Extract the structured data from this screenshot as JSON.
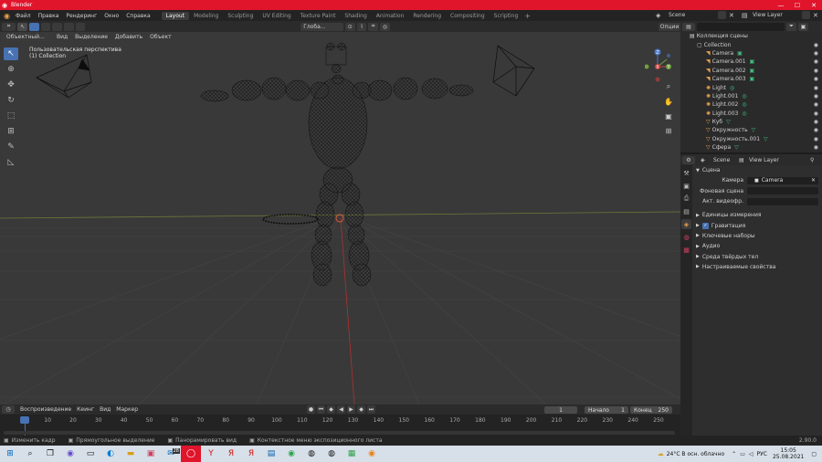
{
  "window": {
    "title": "Blender"
  },
  "menu": [
    "Файл",
    "Правка",
    "Рендеринг",
    "Окно",
    "Справка"
  ],
  "workspaces": [
    "Layout",
    "Modeling",
    "Sculpting",
    "UV Editing",
    "Texture Paint",
    "Shading",
    "Animation",
    "Rendering",
    "Compositing",
    "Scripting"
  ],
  "top_right": {
    "scene": "Scene",
    "view_layer": "View Layer"
  },
  "header": {
    "mode": "Объектный...",
    "menus": [
      "Вид",
      "Выделение",
      "Добавить",
      "Объект"
    ],
    "orientation": "Глоба...",
    "options": "Опции"
  },
  "viewport": {
    "label_line1": "Пользовательская перспектива",
    "label_line2": "(1) Collection",
    "gizmo": {
      "x": "X",
      "y": "Y",
      "z": "Z"
    }
  },
  "timeline_header": {
    "playback": "Воспроизведение",
    "keying": "Кеинг",
    "view": "Вид",
    "marker": "Маркер",
    "current_frame": "1",
    "start_label": "Начало",
    "start": "1",
    "end_label": "Конец",
    "end": "250"
  },
  "timeline_ticks": [
    "1",
    "10",
    "20",
    "30",
    "40",
    "50",
    "60",
    "70",
    "80",
    "90",
    "100",
    "110",
    "120",
    "130",
    "140",
    "150",
    "160",
    "170",
    "180",
    "190",
    "200",
    "210",
    "220",
    "230",
    "240",
    "250"
  ],
  "outliner": {
    "title": "Коллекция сцены",
    "items": [
      {
        "name": "Collection",
        "level": 0
      },
      {
        "name": "Camera",
        "level": 1
      },
      {
        "name": "Camera.001",
        "level": 1
      },
      {
        "name": "Camera.002",
        "level": 1
      },
      {
        "name": "Camera.003",
        "level": 1
      },
      {
        "name": "Light",
        "level": 1
      },
      {
        "name": "Light.001",
        "level": 1
      },
      {
        "name": "Light.002",
        "level": 1
      },
      {
        "name": "Light.003",
        "level": 1
      },
      {
        "name": "Куб",
        "level": 1
      },
      {
        "name": "Окружность",
        "level": 1
      },
      {
        "name": "Окружность.001",
        "level": 1
      },
      {
        "name": "Сфера",
        "level": 1
      }
    ]
  },
  "properties": {
    "scene_name": "Scene",
    "view_layer": "View Layer",
    "panel_scene": "Сцена",
    "camera_label": "Камера",
    "camera_value": "Camera",
    "bg_scene_label": "Фоновая сцена",
    "active_clip_label": "Акт. видеофр.",
    "sections": [
      "Единицы измерения",
      "Гравитация",
      "Ключевые наборы",
      "Аудио",
      "Среда твёрдых тел",
      "Настраиваемые свойства"
    ]
  },
  "statusbar": {
    "left1": "Изменить кадр",
    "left2": "Прямоугольное выделение",
    "left3": "Панорамировать вид",
    "left4": "Контекстное меню экспозиционного листа",
    "version": "2.90.0"
  },
  "taskbar": {
    "weather": "24°C  В осн. облачно",
    "lang": "РУС",
    "time": "15:05",
    "date": "25.08.2021",
    "badge": "28"
  },
  "colors": {
    "accent": "#4772b3",
    "titlebar": "#e0142b",
    "viewport": "#393939"
  }
}
